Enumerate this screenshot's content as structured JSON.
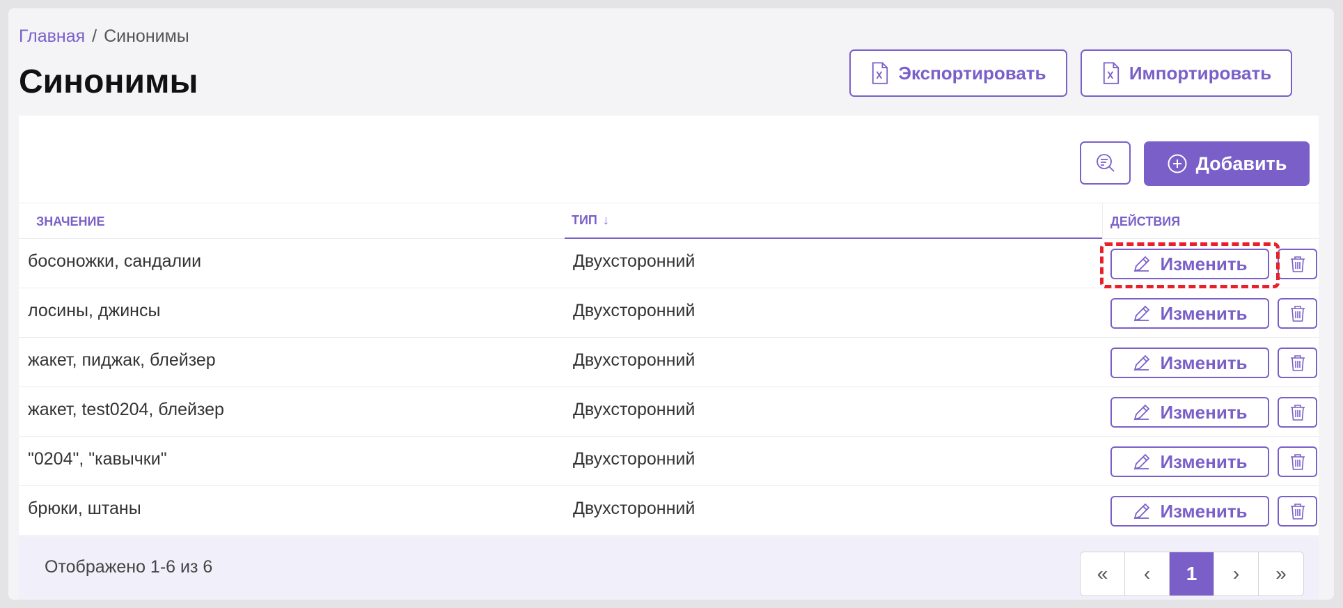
{
  "breadcrumb": {
    "home": "Главная",
    "separator": "/",
    "current": "Синонимы"
  },
  "page": {
    "title": "Синонимы"
  },
  "toolbar": {
    "export_label": "Экспортировать",
    "import_label": "Импортировать",
    "add_label": "Добавить"
  },
  "table": {
    "columns": {
      "value": "ЗНАЧЕНИЕ",
      "type": "ТИП",
      "sort_indicator": "↓",
      "actions": "ДЕЙСТВИЯ"
    },
    "edit_label": "Изменить",
    "rows": [
      {
        "value": "босоножки, сандалии",
        "type": "Двухсторонний"
      },
      {
        "value": "лосины, джинсы",
        "type": "Двухсторонний"
      },
      {
        "value": "жакет, пиджак, блейзер",
        "type": "Двухсторонний"
      },
      {
        "value": "жакет, test0204, блейзер",
        "type": "Двухсторонний"
      },
      {
        "value": "\"0204\", \"кавычки\"",
        "type": "Двухсторонний"
      },
      {
        "value": "брюки, штаны",
        "type": "Двухсторонний"
      }
    ]
  },
  "footer": {
    "summary": "Отображено 1-6 из 6"
  },
  "pagination": {
    "first": "«",
    "prev": "‹",
    "current": "1",
    "next": "›",
    "last": "»"
  },
  "colors": {
    "accent": "#7a5fc9",
    "highlight": "#e8202a"
  }
}
